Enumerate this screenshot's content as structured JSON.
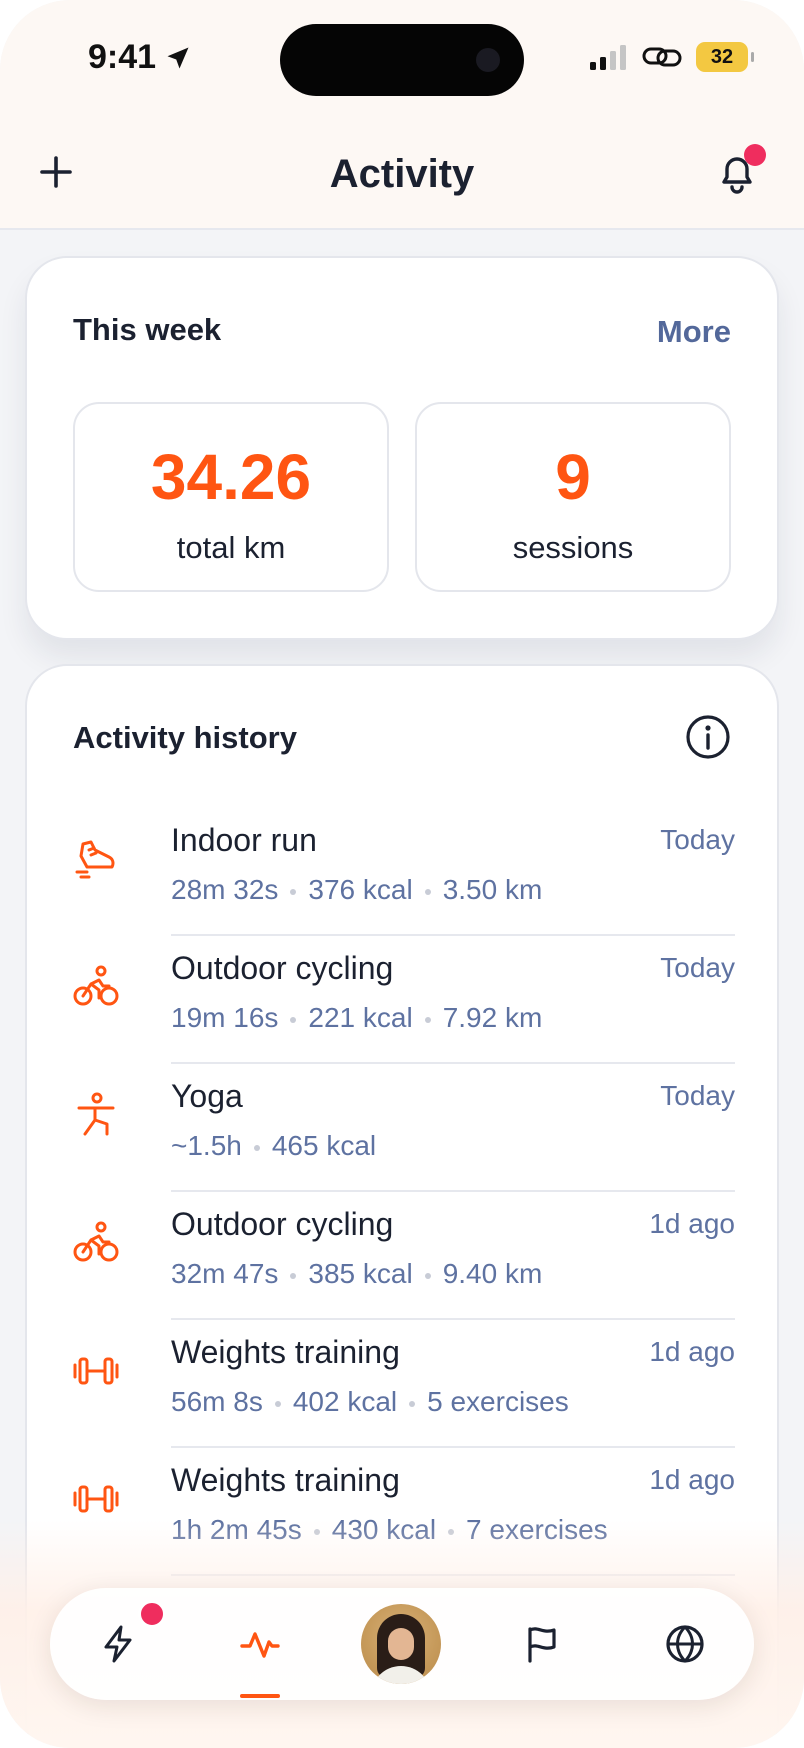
{
  "status_bar": {
    "time": "9:41",
    "battery": "32"
  },
  "header": {
    "title": "Activity"
  },
  "week": {
    "title": "This week",
    "more_label": "More",
    "stats": [
      {
        "value": "34.26",
        "label": "total km"
      },
      {
        "value": "9",
        "label": "sessions"
      }
    ]
  },
  "history": {
    "title": "Activity history",
    "items": [
      {
        "icon": "running-shoe-icon",
        "name": "Indoor run",
        "time": "Today",
        "meta": [
          "28m 32s",
          "376 kcal",
          "3.50 km"
        ]
      },
      {
        "icon": "bike-icon",
        "name": "Outdoor cycling",
        "time": "Today",
        "meta": [
          "19m 16s",
          "221 kcal",
          "7.92 km"
        ]
      },
      {
        "icon": "yoga-icon",
        "name": "Yoga",
        "time": "Today",
        "meta": [
          "~1.5h",
          "465 kcal"
        ]
      },
      {
        "icon": "bike-icon",
        "name": "Outdoor cycling",
        "time": "1d ago",
        "meta": [
          "32m 47s",
          "385 kcal",
          "9.40 km"
        ]
      },
      {
        "icon": "dumbbell-icon",
        "name": "Weights training",
        "time": "1d ago",
        "meta": [
          "56m 8s",
          "402 kcal",
          "5 exercises"
        ]
      },
      {
        "icon": "dumbbell-icon",
        "name": "Weights training",
        "time": "1d ago",
        "meta": [
          "1h 2m 45s",
          "430 kcal",
          "7 exercises"
        ]
      }
    ]
  },
  "tabbar": {
    "items": [
      "lightning-icon",
      "activity-pulse-icon",
      "profile-avatar",
      "flag-icon",
      "globe-icon"
    ],
    "active": "activity-pulse-icon"
  },
  "colors": {
    "accent": "#ff5512",
    "badge": "#ef2d5e",
    "muted": "#5e72a1",
    "text": "#1b2130"
  }
}
